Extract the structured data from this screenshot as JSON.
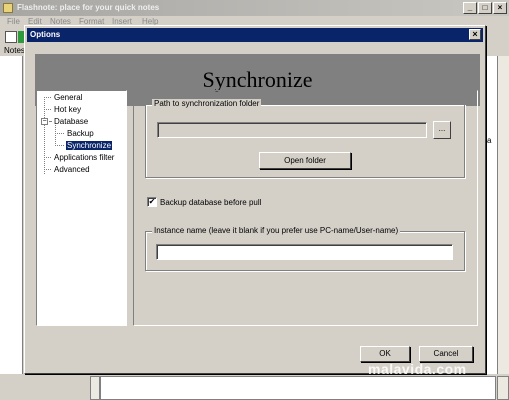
{
  "main_window": {
    "title": "Flashnote: place for your quick notes",
    "menu": [
      "File",
      "Edit",
      "Notes",
      "Format",
      "Insert",
      "Help"
    ],
    "notes_label": "Notes",
    "right_stray_char": "a"
  },
  "dialog": {
    "title": "Options",
    "close_glyph": "×",
    "banner_title": "Synchronize",
    "tree": {
      "general": "General",
      "hotkey": "Hot key",
      "database": "Database",
      "backup": "Backup",
      "synchronize": "Synchronize",
      "apps_filter": "Applications filter",
      "advanced": "Advanced",
      "expander_glyph": "−"
    },
    "sync": {
      "path_group_label": "Path to synchronization folder",
      "path_value": "",
      "browse_label": "...",
      "open_folder_label": "Open folder",
      "backup_checkbox_label": "Backup database before pull",
      "backup_checked": true,
      "check_glyph": "✔",
      "instance_group_label": "Instance name (leave it blank if you prefer use PC-name/User-name)",
      "instance_value": ""
    },
    "ok_label": "OK",
    "cancel_label": "Cancel"
  },
  "watermark": "malavida.com",
  "colors": {
    "titlebar_active": "#0a246a",
    "banner": "#808080",
    "face": "#d4d0c8"
  }
}
